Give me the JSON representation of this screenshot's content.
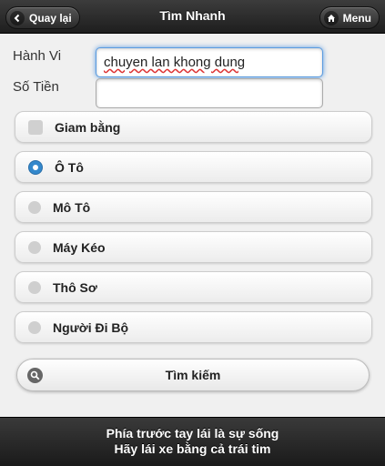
{
  "header": {
    "title": "Tìm Nhanh",
    "back_label": "Quay lại",
    "menu_label": "Menu"
  },
  "form": {
    "behavior_label": "Hành Vi",
    "behavior_value": "chuyen lan khong dung",
    "amount_label": "Số Tiền",
    "amount_value": ""
  },
  "options": {
    "checkbox_label": "Giam bằng",
    "checkbox_checked": false,
    "vehicles": [
      {
        "label": "Ô Tô",
        "selected": true
      },
      {
        "label": "Mô Tô",
        "selected": false
      },
      {
        "label": "Máy Kéo",
        "selected": false
      },
      {
        "label": "Thô Sơ",
        "selected": false
      },
      {
        "label": "Người Đi Bộ",
        "selected": false
      }
    ]
  },
  "search": {
    "label": "Tìm kiếm"
  },
  "footer": {
    "line1": "Phía trước tay lái là sự sống",
    "line2": "Hãy lái xe bằng cả trái tim"
  },
  "colors": {
    "accent": "#3388cc",
    "bar": "#2a2a2a"
  }
}
